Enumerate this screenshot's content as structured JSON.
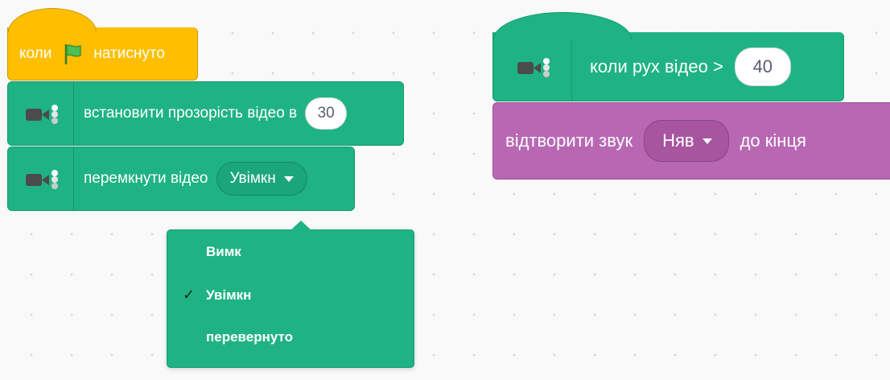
{
  "colors": {
    "events": "#ffbf00",
    "video": "#1fb383",
    "sound": "#b868b3",
    "canvas": "#f9f9f9",
    "input_text": "#575e75"
  },
  "script_left": {
    "hat": {
      "label_before": "коли",
      "icon": "green-flag-icon",
      "label_after": "натиснуто"
    },
    "set_transparency": {
      "icon": "video-camera-icon",
      "label": "встановити прозорість відео в",
      "value": "30"
    },
    "turn_video": {
      "icon": "video-camera-icon",
      "label": "перемкнути відео",
      "selected": "Увімкн"
    },
    "dropdown": {
      "options": [
        {
          "label": "Вимк",
          "checked": false
        },
        {
          "label": "Увімкн",
          "checked": true
        },
        {
          "label": "перевернуто",
          "checked": false
        }
      ],
      "check_glyph": "✓"
    }
  },
  "script_right": {
    "hat": {
      "icon": "video-camera-icon",
      "label": "коли рух відео >",
      "value": "40"
    },
    "play_sound": {
      "label_before": "відтворити звук",
      "sound": "Няв",
      "label_after": "до кінця"
    }
  }
}
